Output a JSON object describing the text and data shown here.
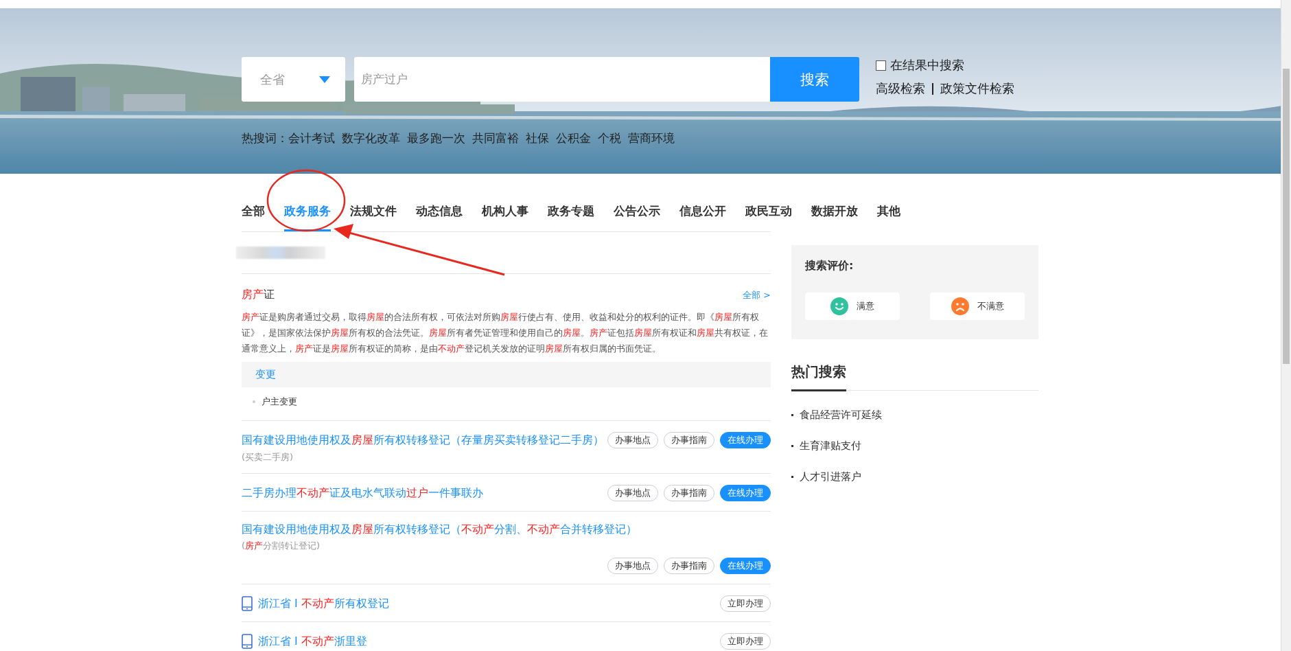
{
  "search": {
    "scope": "全省",
    "value": "房产过户",
    "button": "搜索",
    "within_results": {
      "label": "在结果中搜索",
      "checked": false
    },
    "links": [
      "高级检索",
      "政策文件检索"
    ],
    "hot_label": "热搜词：",
    "hot_words": [
      "会计考试",
      "数字化改革",
      "最多跑一次",
      "共同富裕",
      "社保",
      "公积金",
      "个税",
      "营商环境"
    ]
  },
  "tabs": [
    {
      "label": "全部",
      "selected": false
    },
    {
      "label": "政务服务",
      "selected": true
    },
    {
      "label": "法规文件",
      "selected": false
    },
    {
      "label": "动态信息",
      "selected": false
    },
    {
      "label": "机构人事",
      "selected": false
    },
    {
      "label": "政务专题",
      "selected": false
    },
    {
      "label": "公告公示",
      "selected": false
    },
    {
      "label": "信息公开",
      "selected": false
    },
    {
      "label": "政民互动",
      "selected": false
    },
    {
      "label": "数据开放",
      "selected": false
    },
    {
      "label": "其他",
      "selected": false
    }
  ],
  "card": {
    "title": [
      {
        "text": "房产",
        "hit": true
      },
      {
        "text": "证",
        "hit": false
      }
    ],
    "more": "全部 >",
    "description": [
      {
        "text": "房产",
        "hit": true
      },
      {
        "text": "证是购房者通过交易，取得",
        "hit": false
      },
      {
        "text": "房屋",
        "hit": true
      },
      {
        "text": "的合法所有权，可依法对所购",
        "hit": false
      },
      {
        "text": "房屋",
        "hit": true
      },
      {
        "text": "行使占有、使用、收益和处分的权利的证件。即《",
        "hit": false
      },
      {
        "text": "房屋",
        "hit": true
      },
      {
        "text": "所有权证》，是国家依法保护",
        "hit": false
      },
      {
        "text": "房屋",
        "hit": true
      },
      {
        "text": "所有权的合法凭证。",
        "hit": false
      },
      {
        "text": "房屋",
        "hit": true
      },
      {
        "text": "所有者凭证管理和使用自己的",
        "hit": false
      },
      {
        "text": "房屋",
        "hit": true
      },
      {
        "text": "。",
        "hit": false
      },
      {
        "text": "房产",
        "hit": true
      },
      {
        "text": "证包括",
        "hit": false
      },
      {
        "text": "房屋",
        "hit": true
      },
      {
        "text": "所有权证和",
        "hit": false
      },
      {
        "text": "房屋",
        "hit": true
      },
      {
        "text": "共有权证，在通常意义上，",
        "hit": false
      },
      {
        "text": "房产",
        "hit": true
      },
      {
        "text": "证是",
        "hit": false
      },
      {
        "text": "房屋",
        "hit": true
      },
      {
        "text": "所有权证的简称，是由",
        "hit": false
      },
      {
        "text": "不动产",
        "hit": true
      },
      {
        "text": "登记机关发放的证明",
        "hit": false
      },
      {
        "text": "房屋",
        "hit": true
      },
      {
        "text": "所有权归属的书面凭证。",
        "hit": false
      }
    ],
    "section": "变更",
    "entries": [
      "户主变更"
    ]
  },
  "results": [
    {
      "kind": "service",
      "title": [
        {
          "text": "国有建设用地使用权及",
          "hit": false
        },
        {
          "text": "房屋",
          "hit": true
        },
        {
          "text": "所有权转移登记（存量房买卖转移登记二手房）",
          "hit": false
        }
      ],
      "subtitle": [
        {
          "text": "(买卖二手房)",
          "hit": false
        }
      ],
      "buttons": [
        {
          "label": "办事地点",
          "primary": false
        },
        {
          "label": "办事指南",
          "primary": false
        },
        {
          "label": "在线办理",
          "primary": true
        }
      ],
      "buttons_below": false
    },
    {
      "kind": "service",
      "title": [
        {
          "text": "二手房办理",
          "hit": false
        },
        {
          "text": "不动产",
          "hit": true
        },
        {
          "text": "证及电水气联动",
          "hit": false
        },
        {
          "text": "过户",
          "hit": true
        },
        {
          "text": "一件事联办",
          "hit": false
        }
      ],
      "buttons": [
        {
          "label": "办事地点",
          "primary": false
        },
        {
          "label": "办事指南",
          "primary": false
        },
        {
          "label": "在线办理",
          "primary": true
        }
      ],
      "buttons_below": false
    },
    {
      "kind": "service",
      "title": [
        {
          "text": "国有建设用地使用权及",
          "hit": false
        },
        {
          "text": "房屋",
          "hit": true
        },
        {
          "text": "所有权转移登记（",
          "hit": false
        },
        {
          "text": "不动产",
          "hit": true
        },
        {
          "text": "分割、",
          "hit": false
        },
        {
          "text": "不动产",
          "hit": true
        },
        {
          "text": "合并转移登记）",
          "hit": false
        }
      ],
      "subtitle": [
        {
          "text": "(",
          "hit": false
        },
        {
          "text": "房产",
          "hit": true
        },
        {
          "text": "分割转让登记)",
          "hit": false
        }
      ],
      "buttons": [
        {
          "label": "办事地点",
          "primary": false
        },
        {
          "label": "办事指南",
          "primary": false
        },
        {
          "label": "在线办理",
          "primary": true
        }
      ],
      "buttons_below": true
    },
    {
      "kind": "app",
      "title": [
        {
          "text": "浙江省 I ",
          "hit": false
        },
        {
          "text": "不动产",
          "hit": true
        },
        {
          "text": "所有权登记",
          "hit": false
        }
      ],
      "buttons": [
        {
          "label": "立即办理",
          "primary": false
        }
      ],
      "buttons_below": false
    },
    {
      "kind": "app",
      "title": [
        {
          "text": "浙江省 I ",
          "hit": false
        },
        {
          "text": "不动产",
          "hit": true
        },
        {
          "text": "浙里登",
          "hit": false
        }
      ],
      "buttons": [
        {
          "label": "立即办理",
          "primary": false
        }
      ],
      "buttons_below": false
    }
  ],
  "rating": {
    "title": "搜索评价:",
    "options": [
      {
        "kind": "satisfied",
        "label": "满意",
        "color": "#2ec29e"
      },
      {
        "kind": "unsatisfied",
        "label": "不满意",
        "color": "#ff7a2f"
      }
    ]
  },
  "hot_search": {
    "title": "热门搜索",
    "items": [
      "食品经营许可延续",
      "生育津贴支付",
      "人才引进落户"
    ]
  }
}
